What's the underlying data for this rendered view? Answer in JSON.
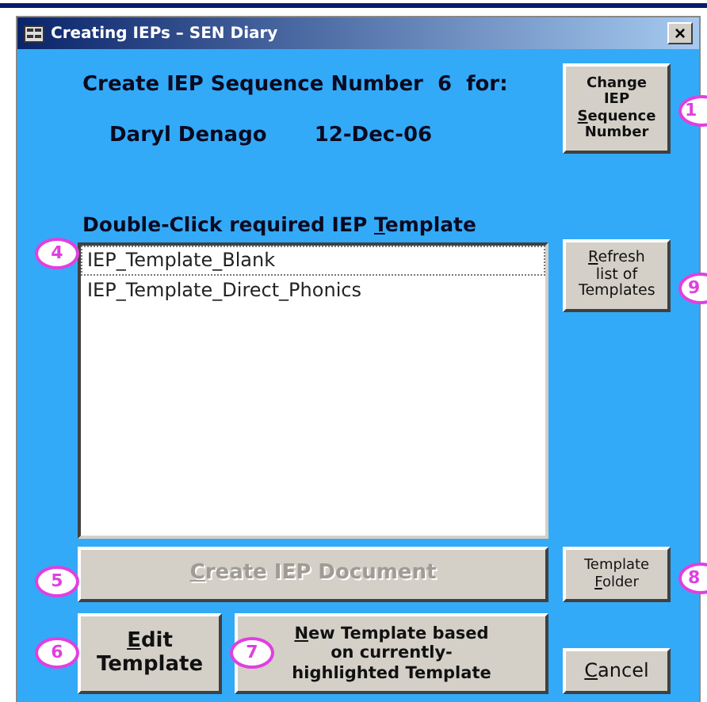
{
  "window": {
    "title": "Creating IEPs – SEN Diary",
    "close": "×"
  },
  "heading": {
    "prefix": "Create IEP Sequence Number",
    "number": "6",
    "suffix": "for:"
  },
  "pupil": {
    "name": "Daryl Denago",
    "date": "12-Dec-06"
  },
  "list_label": {
    "before": "Double-Click required IEP ",
    "key": "T",
    "after": "emplate"
  },
  "templates": [
    {
      "name": "IEP_Template_Blank",
      "focused": true,
      "callout": "4"
    },
    {
      "name": "IEP_Template_Direct_Phonics",
      "focused": false
    }
  ],
  "buttons": [
    {
      "kind": "change",
      "before": "Change IEP ",
      "key": "S",
      "after": "equence Number",
      "disabled": false,
      "callout": "1"
    },
    {
      "kind": "refresh",
      "key": "R",
      "after": "efresh list of Templates",
      "disabled": false,
      "callout": "9"
    },
    {
      "kind": "create",
      "key": "C",
      "after": "reate IEP Document",
      "disabled": true,
      "callout": "5"
    },
    {
      "kind": "folder",
      "before": "Template ",
      "key": "F",
      "after": "older",
      "disabled": false,
      "callout": "8"
    },
    {
      "kind": "edit",
      "key": "E",
      "after": "dit Template",
      "disabled": false,
      "callout": "6"
    },
    {
      "kind": "new",
      "key": "N",
      "after": "ew Template based on currently-highlighted Template",
      "disabled": false,
      "callout": "7"
    },
    {
      "kind": "cancel",
      "key": "C",
      "after": "ancel",
      "disabled": false
    }
  ]
}
